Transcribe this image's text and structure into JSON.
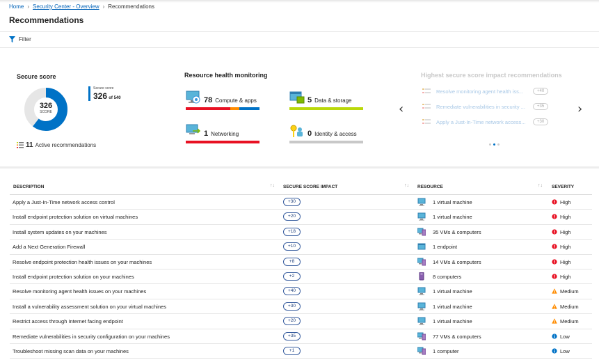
{
  "breadcrumb": {
    "home": "Home",
    "overview": "Security Center - Overview",
    "current": "Recommendations"
  },
  "page_title": "Recommendations",
  "filter_label": "Filter",
  "secure_score": {
    "title": "Secure score",
    "value": "326",
    "center_label": "SCORE",
    "legend_label": "Secure score",
    "legend_value": "326",
    "legend_of": "of 540",
    "fraction": 0.6037,
    "active_count": "11",
    "active_label": "Active recommendations"
  },
  "resource_health": {
    "title": "Resource health monitoring",
    "items": [
      {
        "count": "78",
        "label": "Compute & apps",
        "icon": "compute-icon",
        "bar": [
          {
            "color": "#e81123",
            "weight": 0.6
          },
          {
            "color": "#ff8c00",
            "weight": 0.13
          },
          {
            "color": "#0072c6",
            "weight": 0.27
          }
        ]
      },
      {
        "count": "5",
        "label": "Data & storage",
        "icon": "data-storage-icon",
        "bar": [
          {
            "color": "#bad80a",
            "weight": 1
          }
        ]
      },
      {
        "count": "1",
        "label": "Networking",
        "icon": "networking-icon",
        "bar": [
          {
            "color": "#e81123",
            "weight": 1
          }
        ]
      },
      {
        "count": "0",
        "label": "Identity & access",
        "icon": "identity-icon",
        "bar": [
          {
            "color": "#c8c8c8",
            "weight": 1
          }
        ]
      }
    ]
  },
  "highest_impact": {
    "title": "Highest secure score impact recommendations",
    "items": [
      {
        "text": "Resolve monitoring agent health iss...",
        "impact": "+40"
      },
      {
        "text": "Remediate vulnerabilities in security ...",
        "impact": "+35"
      },
      {
        "text": "Apply a Just-In-Time network access...",
        "impact": "+30"
      }
    ]
  },
  "table": {
    "headers": {
      "description": "DESCRIPTION",
      "impact": "SECURE SCORE IMPACT",
      "resource": "RESOURCE",
      "severity": "SEVERITY"
    },
    "rows": [
      {
        "description": "Apply a Just-In-Time network access control",
        "impact": "+30",
        "resource": "1 virtual machine",
        "resource_icon": "virtual-machine-icon",
        "severity": "High"
      },
      {
        "description": "Install endpoint protection solution on virtual machines",
        "impact": "+20",
        "resource": "1 virtual machine",
        "resource_icon": "virtual-machine-icon",
        "severity": "High"
      },
      {
        "description": "Install system updates on your machines",
        "impact": "+18",
        "resource": "35 VMs & computers",
        "resource_icon": "vms-computers-icon",
        "severity": "High"
      },
      {
        "description": "Add a Next Generation Firewall",
        "impact": "+10",
        "resource": "1 endpoint",
        "resource_icon": "endpoint-icon",
        "severity": "High"
      },
      {
        "description": "Resolve endpoint protection health issues on your machines",
        "impact": "+8",
        "resource": "14 VMs & computers",
        "resource_icon": "vms-computers-icon",
        "severity": "High"
      },
      {
        "description": "Install endpoint protection solution on your machines",
        "impact": "+2",
        "resource": "8 computers",
        "resource_icon": "computer-icon",
        "severity": "High"
      },
      {
        "description": "Resolve monitoring agent health issues on your machines",
        "impact": "+40",
        "resource": "1 virtual machine",
        "resource_icon": "virtual-machine-icon",
        "severity": "Medium"
      },
      {
        "description": "Install a vulnerability assessment solution on your virtual machines",
        "impact": "+30",
        "resource": "1 virtual machine",
        "resource_icon": "virtual-machine-icon",
        "severity": "Medium"
      },
      {
        "description": "Restrict access through Internet facing endpoint",
        "impact": "+20",
        "resource": "1 virtual machine",
        "resource_icon": "virtual-machine-icon",
        "severity": "Medium"
      },
      {
        "description": "Remediate vulnerabilities in security configuration on your machines",
        "impact": "+35",
        "resource": "77 VMs & computers",
        "resource_icon": "vms-computers-icon",
        "severity": "Low"
      },
      {
        "description": "Troubleshoot missing scan data on your machines",
        "impact": "+1",
        "resource": "1 computer",
        "resource_icon": "vms-computers-icon",
        "severity": "Low"
      }
    ]
  },
  "colors": {
    "accent": "#0072c6",
    "high": "#e81123",
    "medium": "#ff8c00",
    "low": "#0072c6"
  }
}
